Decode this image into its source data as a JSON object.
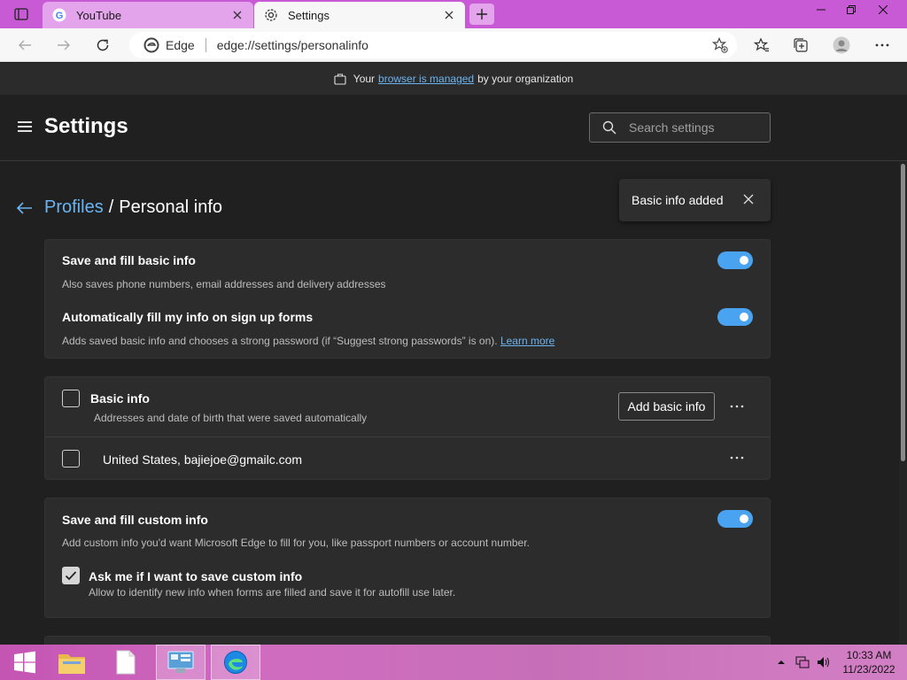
{
  "tabs": [
    {
      "label": "YouTube",
      "icon": "google-icon"
    },
    {
      "label": "Settings",
      "icon": "gear-icon"
    }
  ],
  "address": {
    "browser_label": "Edge",
    "url": "edge://settings/personalinfo"
  },
  "banner": {
    "prefix": "Your",
    "link": "browser is managed",
    "suffix": "by your organization"
  },
  "header": {
    "title": "Settings",
    "search_placeholder": "Search settings"
  },
  "breadcrumb": {
    "parent": "Profiles",
    "separator": "/",
    "current": "Personal info"
  },
  "toast": {
    "text": "Basic info added"
  },
  "basic_fill": {
    "save_title": "Save and fill basic info",
    "save_desc": "Also saves phone numbers, email addresses and delivery addresses",
    "save_enabled": true,
    "auto_title": "Automatically fill my info on sign up forms",
    "auto_desc": "Adds saved basic info and chooses a strong password (if “Suggest strong passwords” is on).",
    "auto_link": "Learn more",
    "auto_enabled": true
  },
  "basic_info": {
    "title": "Basic info",
    "desc": "Addresses and date of birth that were saved automatically",
    "add_button": "Add basic info",
    "entries": [
      {
        "text": "United States, bajiejoe@gmailc.com",
        "checked": false
      }
    ]
  },
  "custom_info": {
    "title": "Save and fill custom info",
    "desc": "Add custom info you'd want Microsoft Edge to fill for you, like passport numbers or account number.",
    "enabled": true,
    "ask_title": "Ask me if I want to save custom info",
    "ask_desc": "Allow to identify new info when forms are filled and save it for autofill use later.",
    "ask_checked": true
  },
  "taskbar": {
    "time": "10:33 AM",
    "date": "11/23/2022"
  },
  "colors": {
    "accent": "#4aa3f0",
    "link": "#6cb4f0",
    "titlebar": "#c85ad6"
  }
}
